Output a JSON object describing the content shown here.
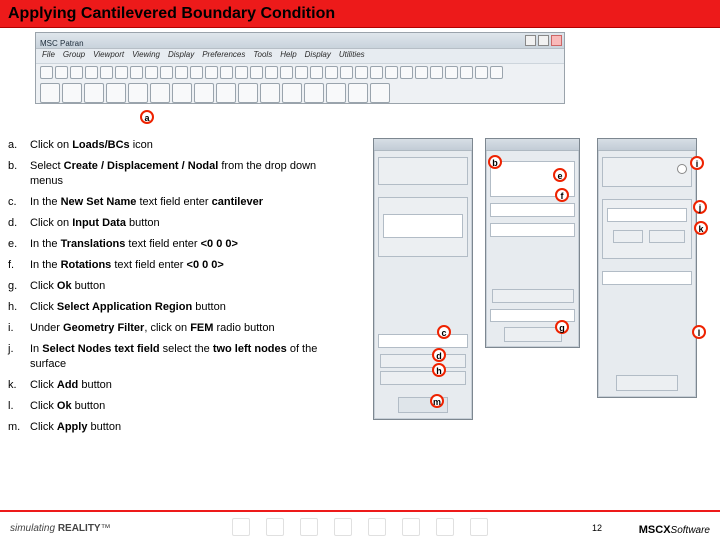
{
  "title": "Applying Cantilevered Boundary Condition",
  "patran": {
    "app_label": "MSC Patran",
    "menu": [
      "File",
      "Group",
      "Viewport",
      "Viewing",
      "Display",
      "Preferences",
      "Tools",
      "Help",
      "Display",
      "Utilities"
    ]
  },
  "steps": [
    {
      "label": "a.",
      "html": "Click on <b>Loads/BCs</b> icon"
    },
    {
      "label": "b.",
      "html": "Select <b>Create / Displacement / Nodal</b> from the drop down menus"
    },
    {
      "label": "c.",
      "html": "In the <b>New Set Name</b> text field enter <b>cantilever</b>"
    },
    {
      "label": "d.",
      "html": "Click on <b>Input Data</b> button"
    },
    {
      "label": "e.",
      "html": "In the <b>Translations</b> text field enter <b>&lt;0 0 0&gt;</b>"
    },
    {
      "label": "f.",
      "html": "In the <b>Rotations</b> text field enter <b>&lt;0 0 0&gt;</b>"
    },
    {
      "label": "g.",
      "html": "Click <b>Ok</b> button"
    },
    {
      "label": "h.",
      "html": "Click <b>Select Application Region</b> button"
    },
    {
      "label": "i.",
      "html": "Under <b>Geometry Filter</b>, click on <b>FEM</b> radio button"
    },
    {
      "label": "j.",
      "html": "In <b>Select Nodes text field</b> select the <b>two left nodes</b> of the surface"
    },
    {
      "label": "k.",
      "html": "Click <b>Add</b> button"
    },
    {
      "label": "l.",
      "html": "Click <b>Ok</b> button"
    },
    {
      "label": "m.",
      "html": "Click <b>Apply</b> button"
    }
  ],
  "markers": {
    "a": "a",
    "b": "b",
    "c": "c",
    "d": "d",
    "e": "e",
    "f": "f",
    "g": "g",
    "h": "h",
    "i": "i",
    "j": "j",
    "k": "k",
    "l": "l",
    "m": "m"
  },
  "footer": {
    "brand_left_pre": "simulating ",
    "brand_left_bold": "REALITY",
    "brand_left_tm": "™",
    "page": "12",
    "brand_right_msc": "MSC",
    "brand_right_x": "X",
    "brand_right_sw": "Software"
  }
}
